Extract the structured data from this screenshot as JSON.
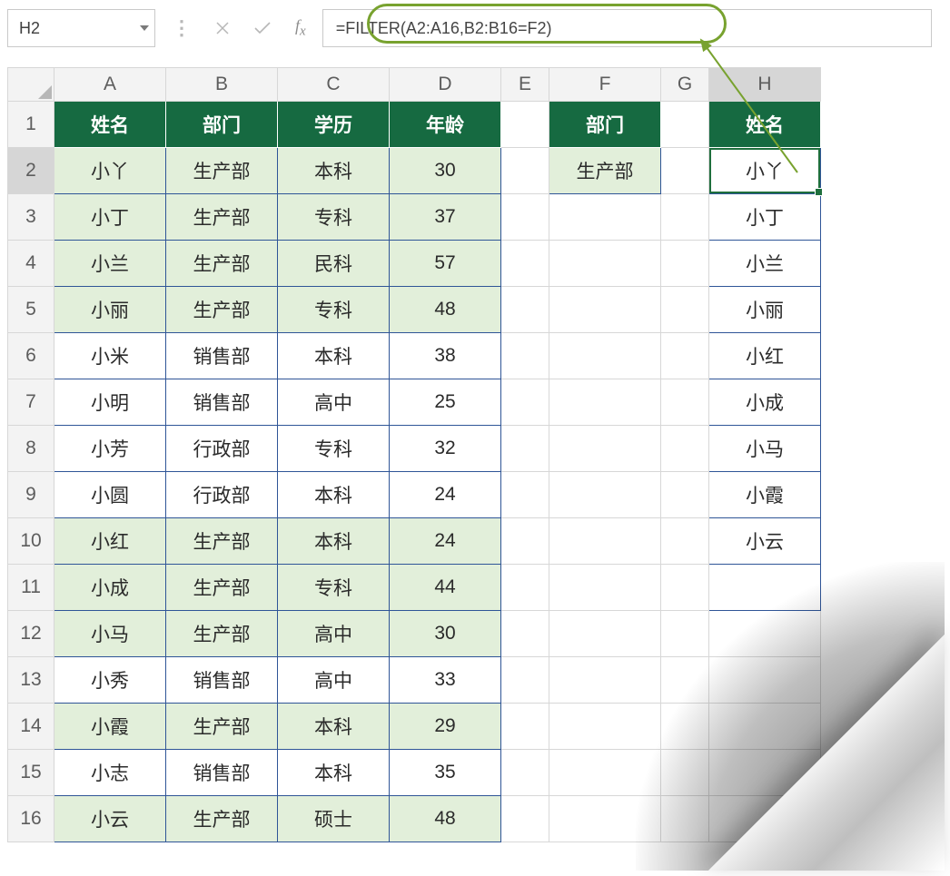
{
  "name_box": "H2",
  "formula": "=FILTER(A2:A16,B2:B16=F2)",
  "columns": [
    "A",
    "B",
    "C",
    "D",
    "E",
    "F",
    "G",
    "H"
  ],
  "selected_column": "H",
  "selected_row": 2,
  "row_count": 16,
  "headers_main": {
    "A": "姓名",
    "B": "部门",
    "C": "学历",
    "D": "年龄"
  },
  "headers_side": {
    "F": "部门",
    "H": "姓名"
  },
  "filter_value": "生产部",
  "table": [
    {
      "name": "小丫",
      "dept": "生产部",
      "edu": "本科",
      "age": 30
    },
    {
      "name": "小丁",
      "dept": "生产部",
      "edu": "专科",
      "age": 37
    },
    {
      "name": "小兰",
      "dept": "生产部",
      "edu": "民科",
      "age": 57
    },
    {
      "name": "小丽",
      "dept": "生产部",
      "edu": "专科",
      "age": 48
    },
    {
      "name": "小米",
      "dept": "销售部",
      "edu": "本科",
      "age": 38
    },
    {
      "name": "小明",
      "dept": "销售部",
      "edu": "高中",
      "age": 25
    },
    {
      "name": "小芳",
      "dept": "行政部",
      "edu": "专科",
      "age": 32
    },
    {
      "name": "小圆",
      "dept": "行政部",
      "edu": "本科",
      "age": 24
    },
    {
      "name": "小红",
      "dept": "生产部",
      "edu": "本科",
      "age": 24
    },
    {
      "name": "小成",
      "dept": "生产部",
      "edu": "专科",
      "age": 44
    },
    {
      "name": "小马",
      "dept": "生产部",
      "edu": "高中",
      "age": 30
    },
    {
      "name": "小秀",
      "dept": "销售部",
      "edu": "高中",
      "age": 33
    },
    {
      "name": "小霞",
      "dept": "生产部",
      "edu": "本科",
      "age": 29
    },
    {
      "name": "小志",
      "dept": "销售部",
      "edu": "本科",
      "age": 35
    },
    {
      "name": "小云",
      "dept": "生产部",
      "edu": "硕士",
      "age": 48
    }
  ],
  "result": [
    "小丫",
    "小丁",
    "小兰",
    "小丽",
    "小红",
    "小成",
    "小马",
    "小霞",
    "小云"
  ]
}
